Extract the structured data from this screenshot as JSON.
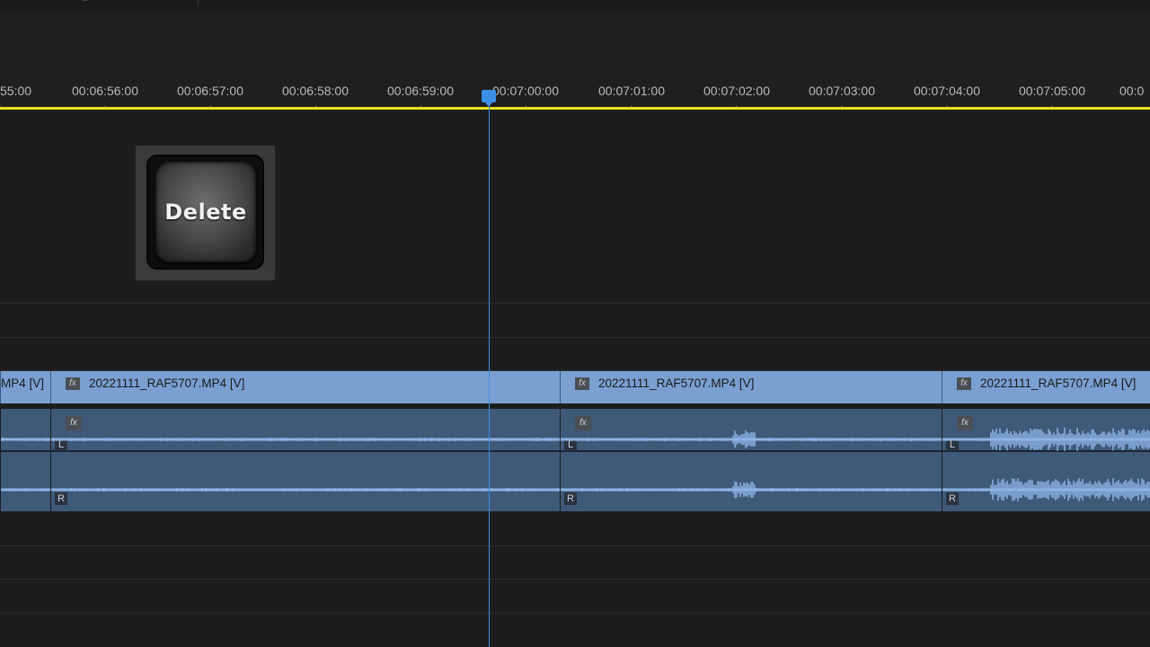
{
  "ruler": {
    "timecodes": [
      "55:00",
      "00:06:56:00",
      "00:06:57:00",
      "00:06:58:00",
      "00:06:59:00",
      "00:07:00:00",
      "00:07:01:00",
      "00:07:02:00",
      "00:07:03:00",
      "00:07:04:00",
      "00:07:05:00",
      "00:0"
    ]
  },
  "overlay": {
    "key_label": "Delete"
  },
  "video_clips": [
    {
      "name": "MP4 [V]"
    },
    {
      "fx": "fx",
      "name": "20221111_RAF5707.MP4 [V]"
    },
    {
      "fx": "fx",
      "name": "20221111_RAF5707.MP4 [V]"
    },
    {
      "fx": "fx",
      "name": "20221111_RAF5707.MP4 [V]"
    }
  ],
  "audio_clips": [
    {
      "fx": "",
      "left": "",
      "right": ""
    },
    {
      "fx": "fx",
      "left": "L",
      "right": "R"
    },
    {
      "fx": "fx",
      "left": "L",
      "right": "R"
    },
    {
      "fx": "fx",
      "left": "L",
      "right": "R"
    }
  ],
  "colors": {
    "video_clip": "#7aa0d2",
    "audio_clip": "#3f5979",
    "playhead": "#3c8fe6",
    "work_area": "#e8e21a"
  },
  "icons": {
    "fx_badge": "fx-effect-icon",
    "playhead": "playhead-marker-icon"
  }
}
